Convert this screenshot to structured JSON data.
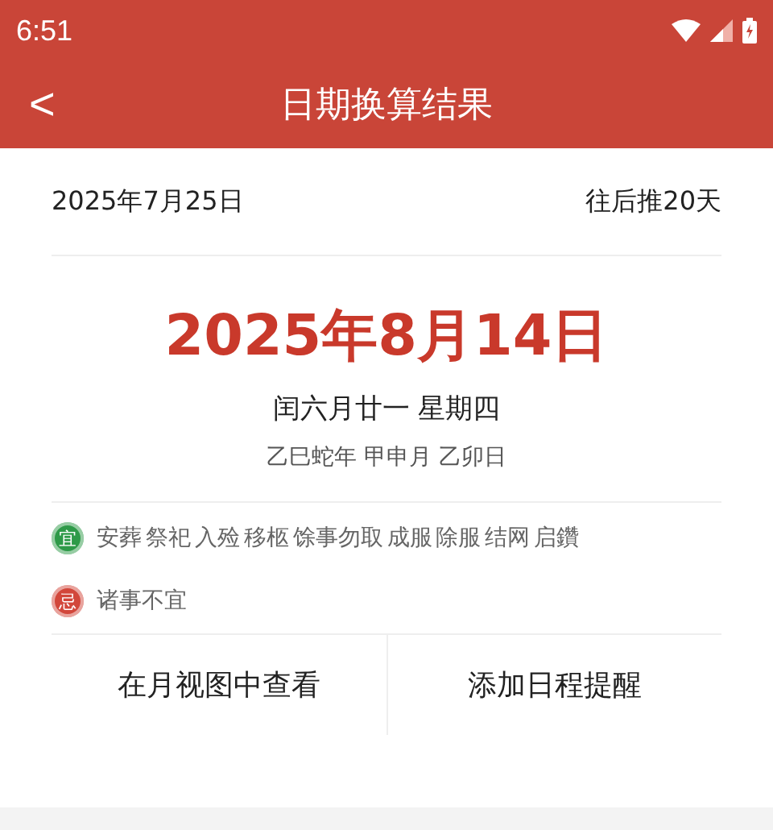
{
  "status_bar": {
    "time": "6:51"
  },
  "app_bar": {
    "back": "<",
    "title": "日期换算结果"
  },
  "summary": {
    "start_date": "2025年7月25日",
    "offset": "往后推20天"
  },
  "result": {
    "date": "2025年8月14日",
    "lunar": "闰六月廿一 星期四",
    "ganzhi": "乙巳蛇年 甲申月 乙卯日"
  },
  "almanac": [
    {
      "badge": "宜",
      "color": "#2e9a48",
      "text": "安葬 祭祀 入殓 移柩 馀事勿取 成服 除服 结网 启鑽"
    },
    {
      "badge": "忌",
      "color": "#d2473b",
      "text": "诸事不宜"
    }
  ],
  "actions": [
    "在月视图中查看",
    "添加日程提醒"
  ]
}
